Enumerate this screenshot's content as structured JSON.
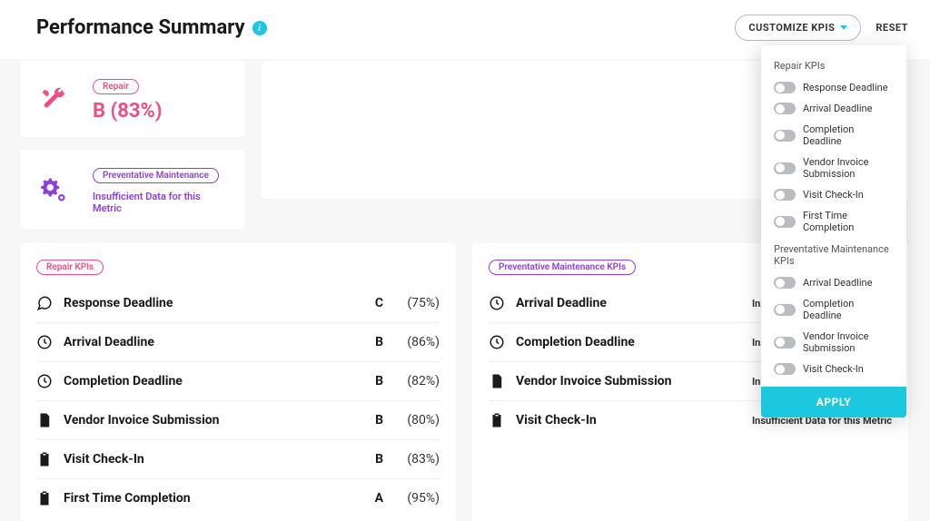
{
  "header": {
    "title": "Performance Summary",
    "customize_label": "CUSTOMIZE KPIS",
    "reset_label": "RESET"
  },
  "summary": {
    "repair": {
      "badge": "Repair",
      "grade": "B (83%)"
    },
    "pm": {
      "badge": "Preventative Maintenance",
      "text": "Insufficient Data for this Metric"
    }
  },
  "repair_kpis": {
    "badge": "Repair KPIs",
    "items": [
      {
        "icon": "chat-icon",
        "name": "Response Deadline",
        "grade": "C",
        "pct": "(75%)"
      },
      {
        "icon": "clock-icon",
        "name": "Arrival Deadline",
        "grade": "B",
        "pct": "(86%)"
      },
      {
        "icon": "clock-icon",
        "name": "Completion Deadline",
        "grade": "B",
        "pct": "(82%)"
      },
      {
        "icon": "doc-icon",
        "name": "Vendor Invoice Submission",
        "grade": "B",
        "pct": "(80%)"
      },
      {
        "icon": "clipboard-icon",
        "name": "Visit Check-In",
        "grade": "B",
        "pct": "(83%)"
      },
      {
        "icon": "clipboard-icon",
        "name": "First Time Completion",
        "grade": "A",
        "pct": "(95%)"
      }
    ]
  },
  "pm_kpis": {
    "badge": "Preventative Maintenance KPIs",
    "insufficient_label": "Insufficient Data for this Metric",
    "items": [
      {
        "icon": "clock-icon",
        "name": "Arrival Deadline"
      },
      {
        "icon": "clock-icon",
        "name": "Completion Deadline"
      },
      {
        "icon": "doc-icon",
        "name": "Vendor Invoice Submission"
      },
      {
        "icon": "clipboard-icon",
        "name": "Visit Check-In"
      }
    ]
  },
  "dropdown": {
    "sections": [
      {
        "heading": "Repair KPIs",
        "items": [
          "Response Deadline",
          "Arrival Deadline",
          "Completion Deadline",
          "Vendor Invoice Submission",
          "Visit Check-In",
          "First Time Completion"
        ]
      },
      {
        "heading": "Preventative Maintenance KPIs",
        "items": [
          "Arrival Deadline",
          "Completion Deadline",
          "Vendor Invoice Submission",
          "Visit Check-In"
        ]
      }
    ],
    "apply_label": "APPLY"
  }
}
